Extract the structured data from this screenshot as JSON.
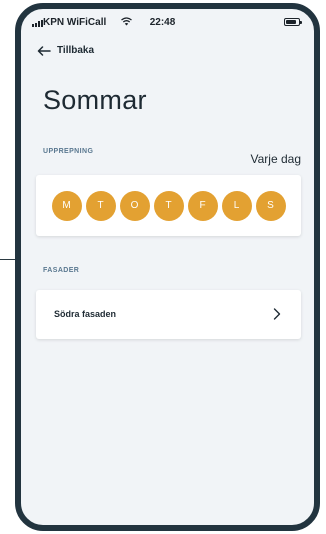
{
  "status_bar": {
    "carrier": "KPN WiFiCall",
    "time": "22:48",
    "icons": [
      "signal-icon",
      "wifi-icon",
      "battery-icon"
    ]
  },
  "nav": {
    "back_label": "Tillbaka",
    "back_icon": "arrow-left-icon"
  },
  "page": {
    "title": "Sommar"
  },
  "repeat": {
    "section_label": "UPPREPNING",
    "value": "Varje dag",
    "days": [
      "M",
      "T",
      "O",
      "T",
      "F",
      "L",
      "S"
    ],
    "day_color": "#e3a132"
  },
  "facades": {
    "section_label": "FASADER",
    "items": [
      {
        "label": "Södra fasaden",
        "icon": "chevron-right-icon"
      }
    ]
  }
}
